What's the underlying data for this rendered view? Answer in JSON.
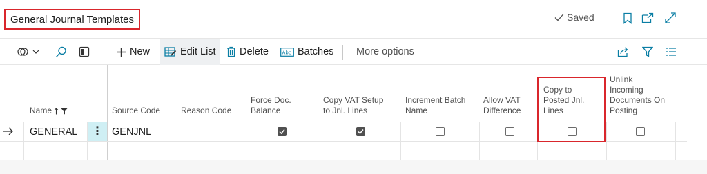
{
  "header": {
    "title": "General Journal Templates",
    "saved_label": "Saved",
    "icons": [
      "bookmark-icon",
      "open-new-window-icon",
      "expand-icon"
    ]
  },
  "toolbar": {
    "new_label": "New",
    "edit_list_label": "Edit List",
    "delete_label": "Delete",
    "batches_label": "Batches",
    "more_options_label": "More options"
  },
  "grid": {
    "columns": {
      "name": "Name",
      "source_code": "Source Code",
      "reason_code": "Reason Code",
      "force_doc_balance": [
        "Force Doc.",
        "Balance"
      ],
      "copy_vat_setup": [
        "Copy VAT Setup",
        "to Jnl. Lines"
      ],
      "increment_batch_name": [
        "Increment Batch",
        "Name"
      ],
      "allow_vat_difference": [
        "Allow VAT",
        "Difference"
      ],
      "copy_to_posted": [
        "Copy to",
        "Posted Jnl.",
        "Lines"
      ],
      "unlink_incoming": [
        "Unlink",
        "Incoming",
        "Documents On",
        "Posting"
      ]
    },
    "rows": [
      {
        "name": "GENERAL",
        "source_code": "GENJNL",
        "reason_code": "",
        "force_doc_balance": true,
        "copy_vat_setup": true,
        "increment_batch_name": false,
        "allow_vat_difference": false,
        "copy_to_posted": false,
        "unlink_incoming": false
      }
    ]
  },
  "colors": {
    "highlight": "#d9262c",
    "selected_cell": "#cfeff4",
    "accent": "#0a7ea4"
  }
}
